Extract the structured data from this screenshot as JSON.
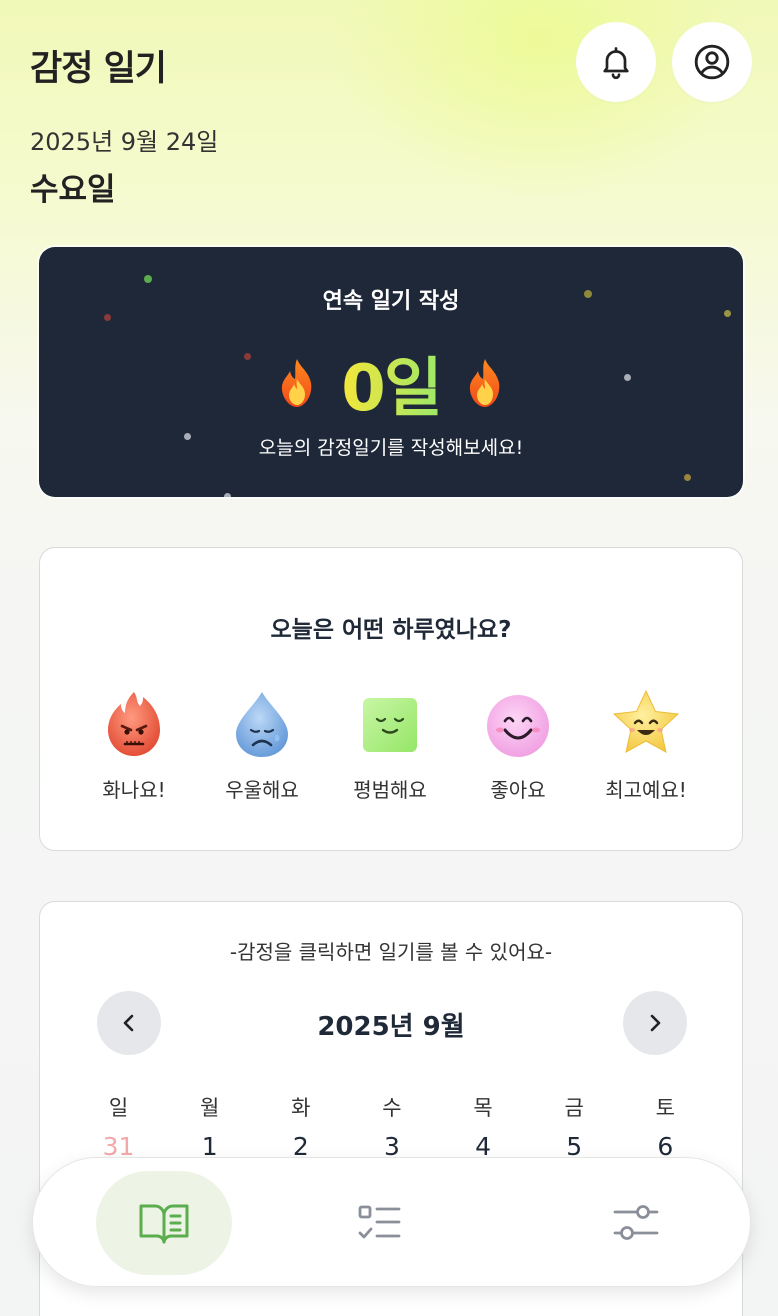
{
  "header": {
    "title": "감정 일기",
    "date": "2025년 9월 24일",
    "weekday": "수요일"
  },
  "streak": {
    "title": "연속 일기 작성",
    "count": "0일",
    "message": "오늘의 감정일기를 작성해보세요!",
    "fire_icon": "fire-emoji"
  },
  "emotion": {
    "question": "오늘은 어떤 하루였나요?",
    "items": [
      {
        "label": "화나요!",
        "icon": "angry-flame-icon",
        "color": "#e8553c"
      },
      {
        "label": "우울해요",
        "icon": "sad-drop-icon",
        "color": "#6ea2dc"
      },
      {
        "label": "평범해요",
        "icon": "neutral-square-icon",
        "color": "#a8ec78"
      },
      {
        "label": "좋아요",
        "icon": "happy-circle-icon",
        "color": "#f4a6e4"
      },
      {
        "label": "최고예요!",
        "icon": "star-icon",
        "color": "#f7d65a"
      }
    ]
  },
  "calendar": {
    "hint": "-감정을 클릭하면 일기를 볼 수 있어요-",
    "month": "2025년 9월",
    "weekdays": [
      "일",
      "월",
      "화",
      "수",
      "목",
      "금",
      "토"
    ],
    "first_row": [
      "31",
      "1",
      "2",
      "3",
      "4",
      "5",
      "6"
    ]
  },
  "bottom_nav": {
    "items": [
      {
        "name": "diary",
        "icon": "open-book-icon",
        "active": true
      },
      {
        "name": "list",
        "icon": "checklist-icon",
        "active": false
      },
      {
        "name": "settings",
        "icon": "sliders-icon",
        "active": false
      }
    ]
  },
  "colors": {
    "accent_green": "#5cad4d",
    "streak_bg": "#1f2839",
    "other_month_date": "#f3a9a9"
  }
}
